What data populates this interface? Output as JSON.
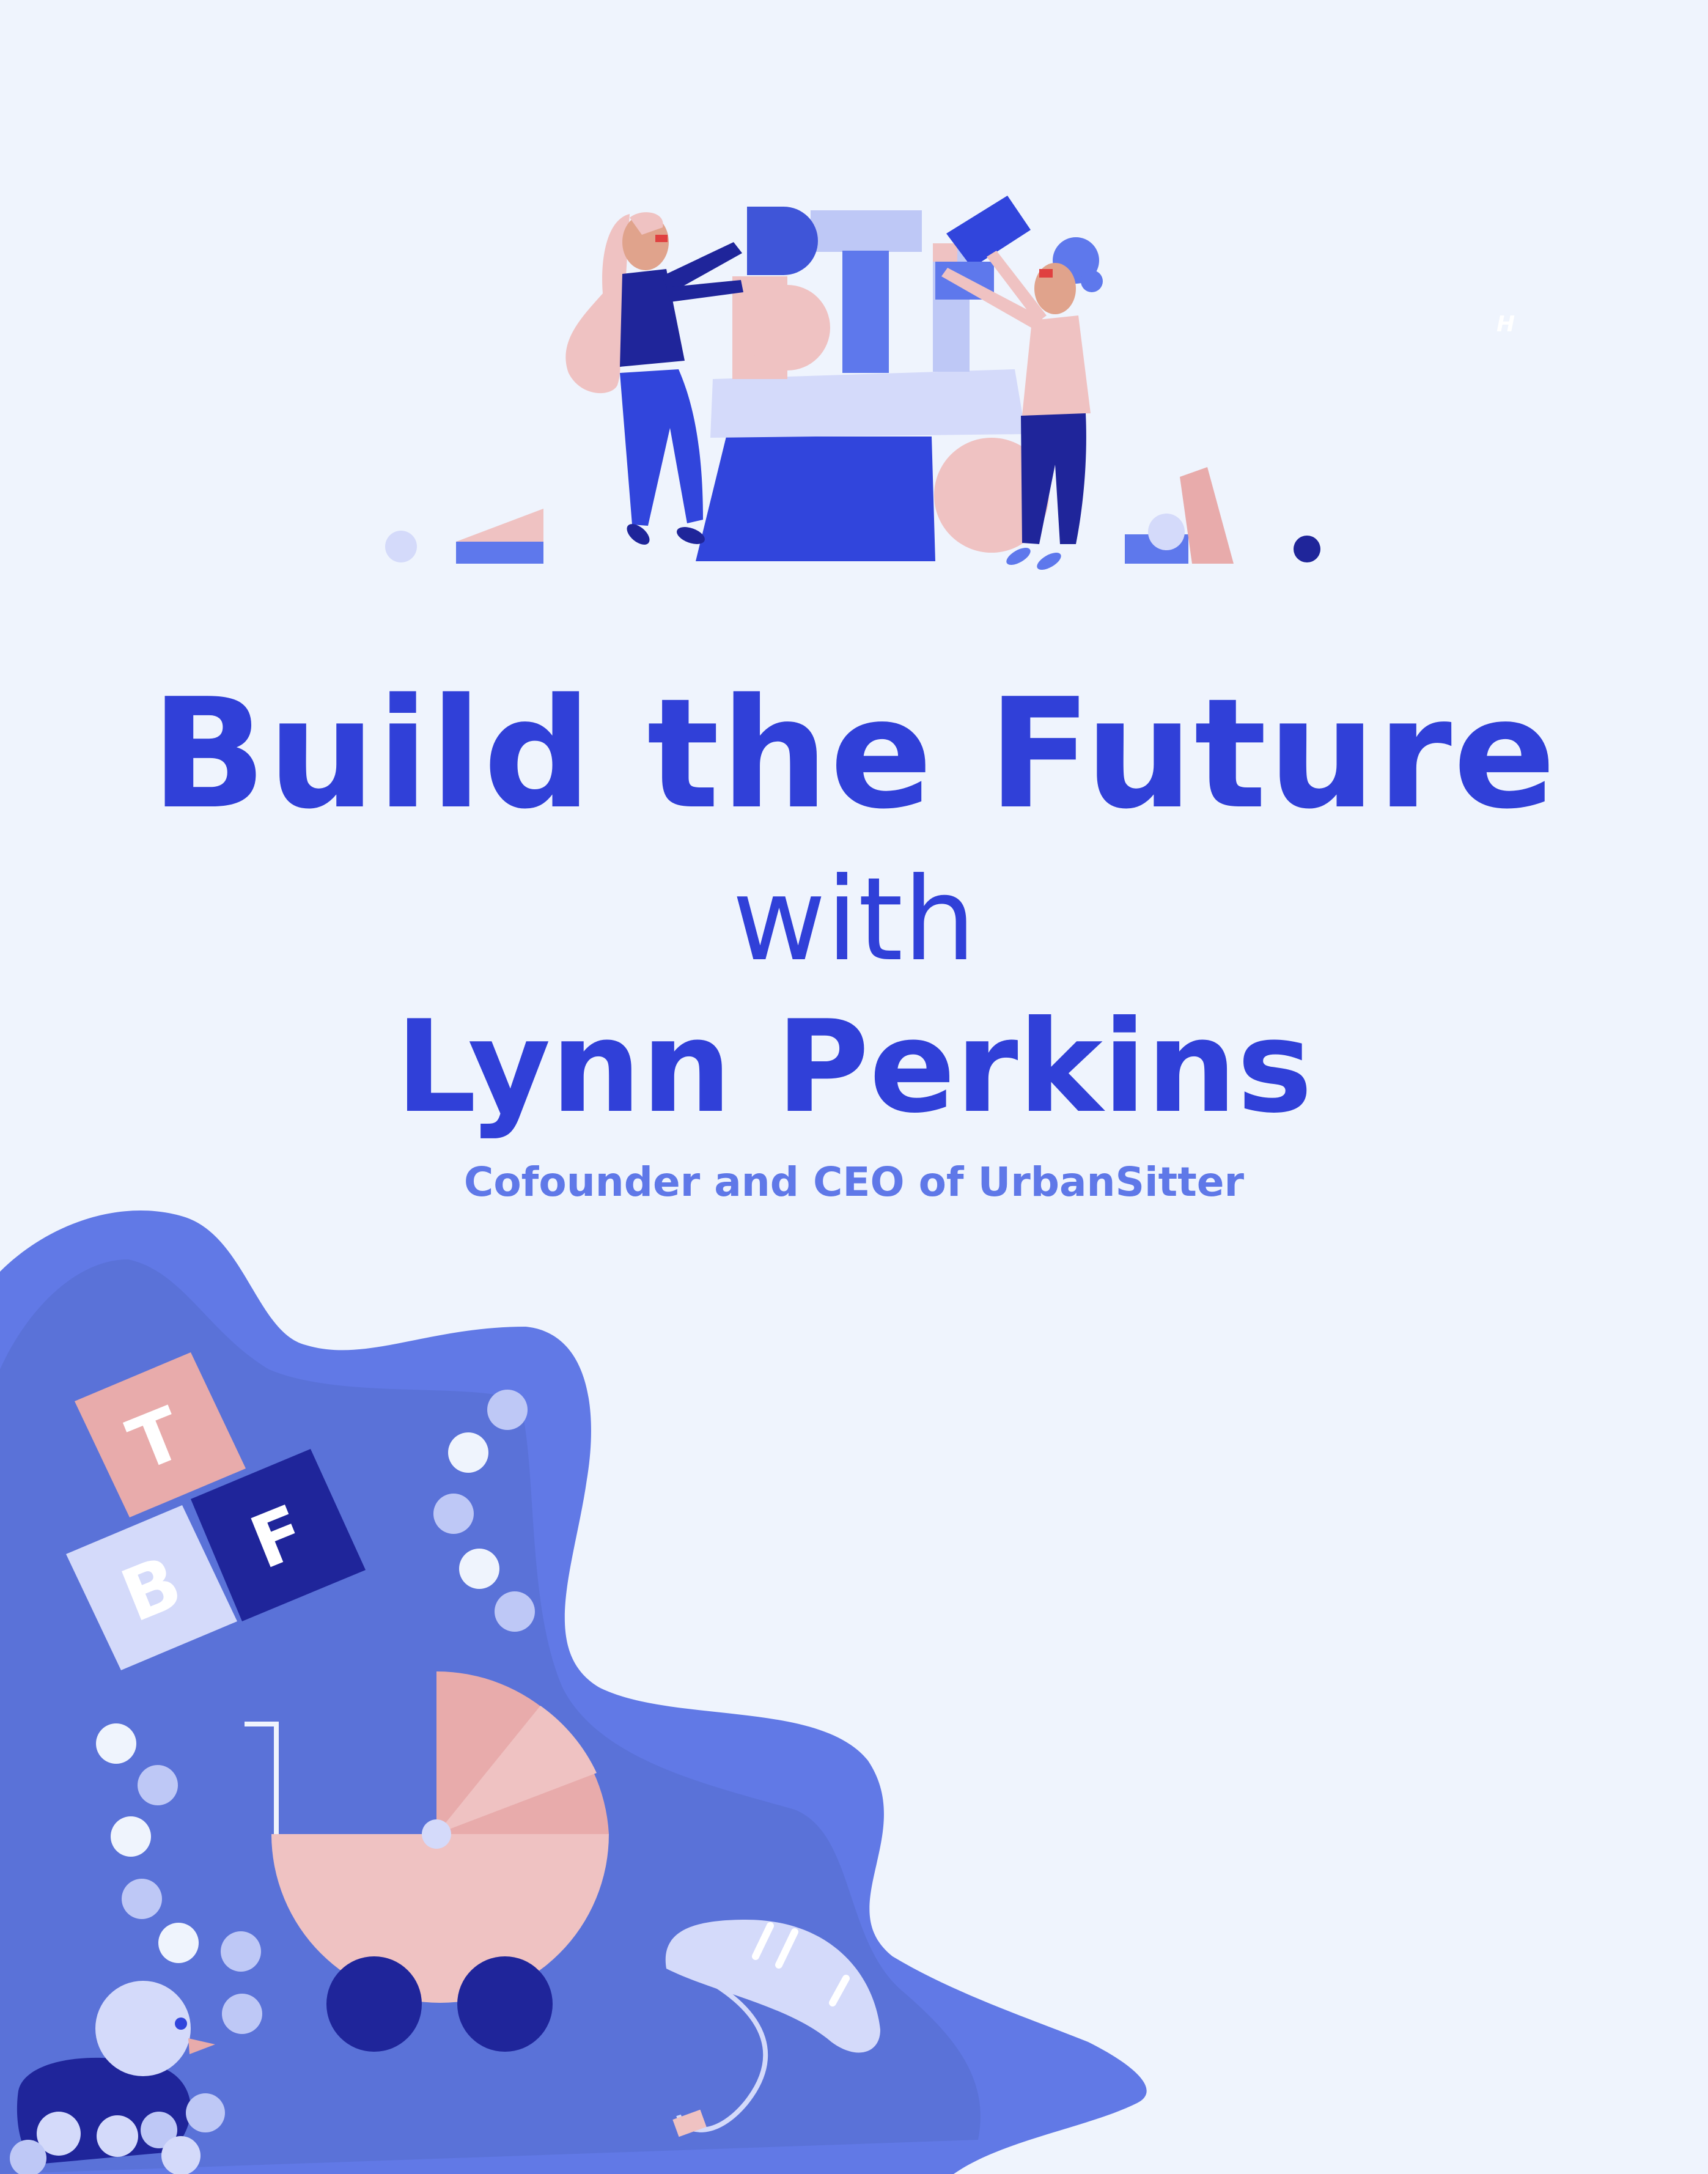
{
  "title": {
    "line1": "Build the Future",
    "line2": "with",
    "line3": "Lynn Perkins"
  },
  "subtitle": "Cofounder and CEO of UrbanSitter",
  "corner_mark": "H",
  "blocks": {
    "top": "T",
    "left": "B",
    "right": "F"
  },
  "colors": {
    "background": "#eff4fd",
    "title": "#3040d8",
    "subtitle": "#5f78e8",
    "blob": "#6179e6",
    "pink": "#efc2c2",
    "navy": "#1f259a",
    "lavender": "#d4dafa"
  }
}
